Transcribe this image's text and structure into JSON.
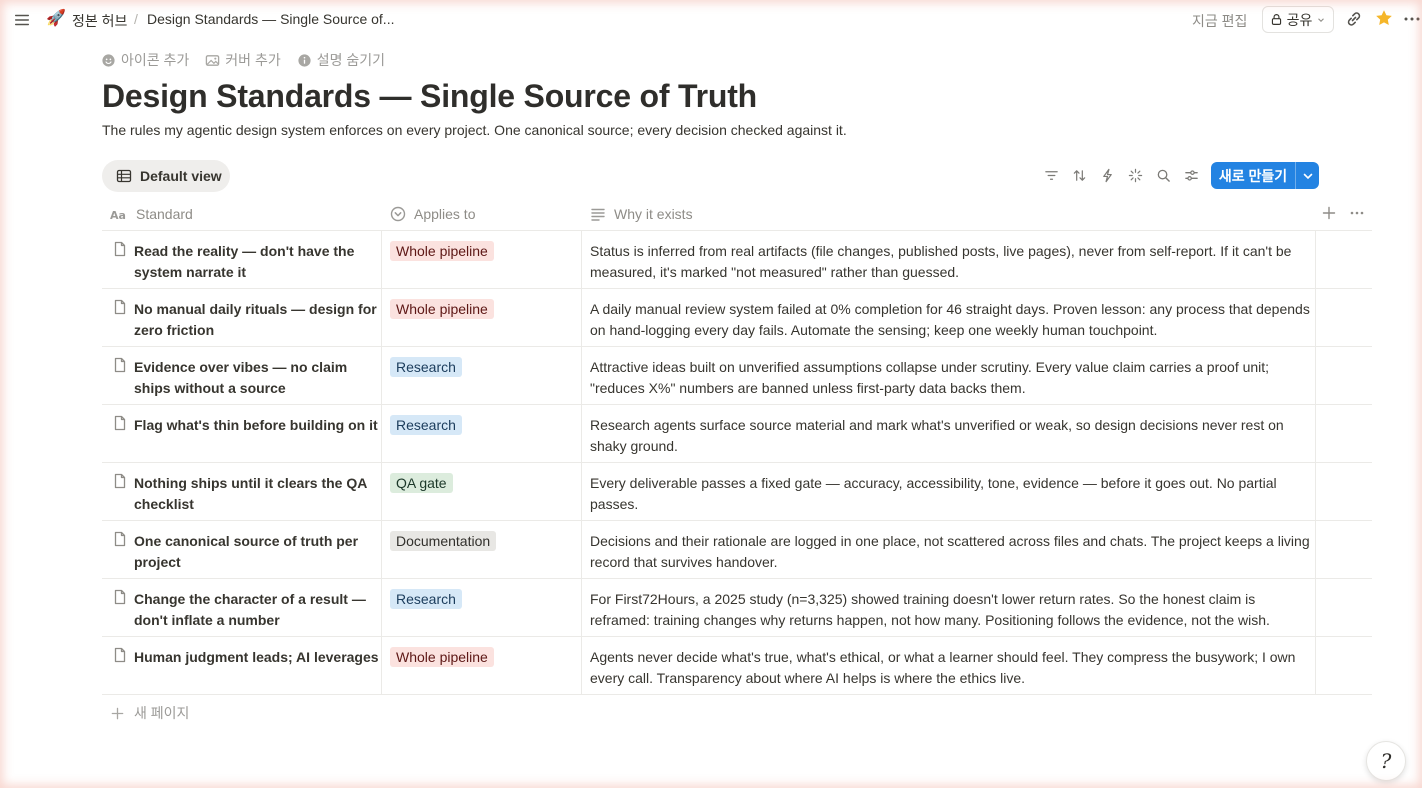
{
  "topbar": {
    "page_emoji": "🚀",
    "breadcrumb_parent": "정본 허브",
    "breadcrumb_separator": "/",
    "breadcrumb_current": "Design Standards — Single Source of...",
    "edited_label": "지금 편집",
    "share_label": "공유"
  },
  "page": {
    "actions": {
      "add_icon": "아이콘 추가",
      "add_cover": "커버 추가",
      "hide_description": "설명 숨기기"
    },
    "title": "Design Standards — Single Source of Truth",
    "description": "The rules my agentic design system enforces on every project. One canonical source; every decision checked against it."
  },
  "view": {
    "tab_label": "Default view",
    "new_button_label": "새로 만들기"
  },
  "table": {
    "columns": {
      "standard": "Standard",
      "applies_to": "Applies to",
      "why": "Why it exists"
    },
    "rows": [
      {
        "title": "Read the reality — don't have the system narrate it",
        "tag": "Whole pipeline",
        "why": "Status is inferred from real artifacts (file changes, published posts, live pages), never from self-report. If it can't be measured, it's marked \"not measured\" rather than guessed."
      },
      {
        "title": "No manual daily rituals — design for zero friction",
        "tag": "Whole pipeline",
        "why": "A daily manual review system failed at 0% completion for 46 straight days. Proven lesson: any process that depends on hand-logging every day fails. Automate the sensing; keep one weekly human touchpoint."
      },
      {
        "title": "Evidence over vibes — no claim ships without a source",
        "tag": "Research",
        "why": "Attractive ideas built on unverified assumptions collapse under scrutiny. Every value claim carries a proof unit; \"reduces X%\" numbers are banned unless first-party data backs them."
      },
      {
        "title": "Flag what's thin before building on it",
        "tag": "Research",
        "why": "Research agents surface source material and mark what's unverified or weak, so design decisions never rest on shaky ground."
      },
      {
        "title": "Nothing ships until it clears the QA checklist",
        "tag": "QA gate",
        "why": "Every deliverable passes a fixed gate — accuracy, accessibility, tone, evidence — before it goes out. No partial passes."
      },
      {
        "title": "One canonical source of truth per project",
        "tag": "Documentation",
        "why": "Decisions and their rationale are logged in one place, not scattered across files and chats. The project keeps a living record that survives handover."
      },
      {
        "title": "Change the character of a result — don't inflate a number",
        "tag": "Research",
        "why": "For First72Hours, a 2025 study (n=3,325) showed training doesn't lower return rates. So the honest claim is reframed: training changes why returns happen, not how many. Positioning follows the evidence, not the wish."
      },
      {
        "title": "Human judgment leads; AI leverages",
        "tag": "Whole pipeline",
        "why": "Agents never decide what's true, what's ethical, or what a learner should feel. They compress the busywork; I own every call. Transparency about where AI helps is where the ethics live."
      }
    ],
    "new_page_label": "새 페이지"
  },
  "tag_colors": {
    "Whole pipeline": {
      "bg": "#fbe2df",
      "fg": "#5d1715"
    },
    "Research": {
      "bg": "#d6e8f7",
      "fg": "#1b3c5c"
    },
    "QA gate": {
      "bg": "#dcecdd",
      "fg": "#1c3829"
    },
    "Documentation": {
      "bg": "#e8e7e4",
      "fg": "#32302c"
    }
  },
  "accent_color": "#2383e2",
  "star_color": "#f5b62a",
  "help_glyph": "?"
}
